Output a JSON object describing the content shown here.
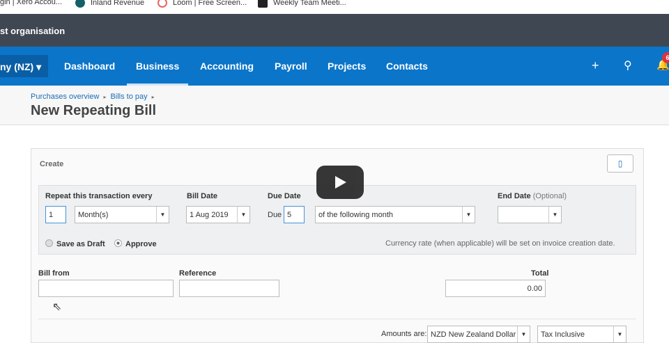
{
  "bookmarks": [
    {
      "label": "gin | Xero Accou...",
      "color": "#1ab4d7"
    },
    {
      "label": "Inland Revenue",
      "color": "#14606a"
    },
    {
      "label": "Loom | Free Screen...",
      "color": "#e8635c"
    },
    {
      "label": "Weekly Team Meeti...",
      "color": "#222222"
    }
  ],
  "org_name": "st organisation",
  "nav": {
    "org_selector": "ny (NZ)",
    "items": [
      "Dashboard",
      "Business",
      "Accounting",
      "Payroll",
      "Projects",
      "Contacts"
    ],
    "active": "Business",
    "notification_count": "6",
    "accent": "#0b75c9"
  },
  "breadcrumb": [
    "Purchases overview",
    "Bills to pay"
  ],
  "page_title": "New Repeating Bill",
  "create_label": "Create",
  "repeat": {
    "label": "Repeat this transaction every",
    "count": "1",
    "unit": "Month(s)"
  },
  "bill_date": {
    "label": "Bill Date",
    "value": "1 Aug 2019"
  },
  "due_date": {
    "label": "Due Date",
    "prefix": "Due",
    "value": "5",
    "term": "of the following month"
  },
  "end_date": {
    "label": "End Date",
    "optional": "(Optional)",
    "value": ""
  },
  "save_options": {
    "draft": "Save as Draft",
    "approve": "Approve",
    "selected": "Approve"
  },
  "currency_note": "Currency rate (when applicable) will be set on invoice creation date.",
  "bill_from": {
    "label": "Bill from",
    "value": ""
  },
  "reference": {
    "label": "Reference",
    "value": ""
  },
  "total": {
    "label": "Total",
    "value": "0.00"
  },
  "amounts": {
    "label": "Amounts are:",
    "currency": "NZD New Zealand Dollar",
    "tax": "Tax Inclusive"
  }
}
